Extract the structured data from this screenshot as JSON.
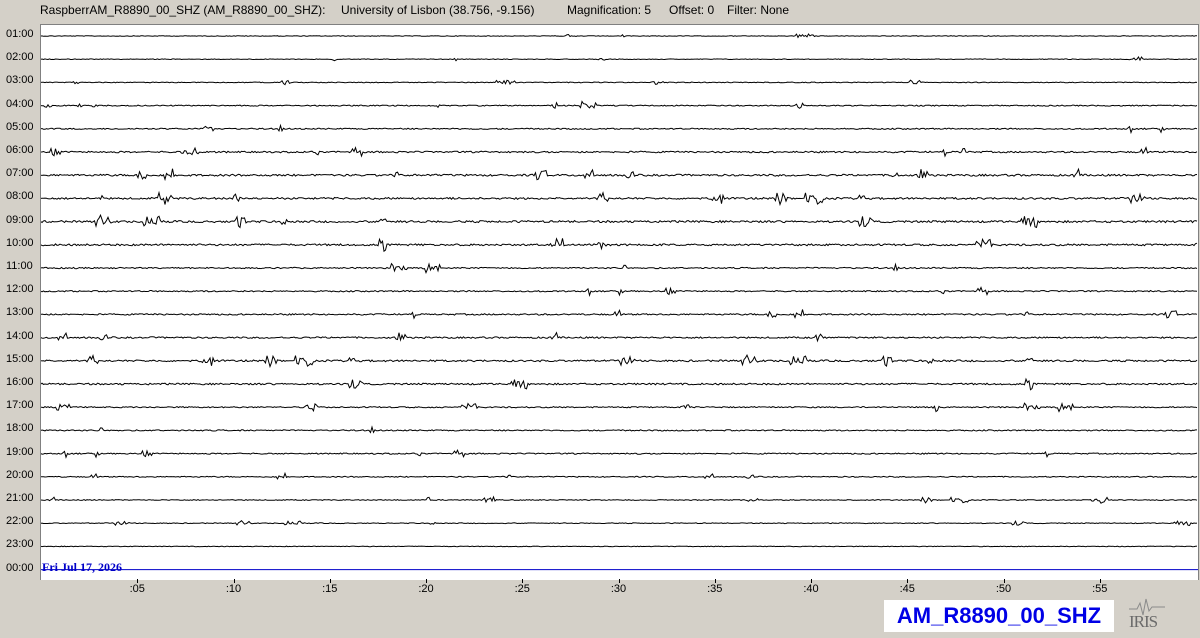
{
  "header": {
    "channel": "RaspberrAM_R8890_00_SHZ (AM_R8890_00_SHZ):",
    "location": "University of Lisbon (38.756, -9.156)",
    "magnification": "Magnification: 5",
    "offset": "Offset: 0",
    "filter": "Filter: None"
  },
  "hours": [
    "01:00",
    "02:00",
    "03:00",
    "04:00",
    "05:00",
    "06:00",
    "07:00",
    "08:00",
    "09:00",
    "10:00",
    "11:00",
    "12:00",
    "13:00",
    "14:00",
    "15:00",
    "16:00",
    "17:00",
    "18:00",
    "19:00",
    "20:00",
    "21:00",
    "22:00",
    "23:00",
    "00:00"
  ],
  "trace_amplitude": [
    0.25,
    0.3,
    0.35,
    0.5,
    0.55,
    0.7,
    0.85,
    0.85,
    0.9,
    0.85,
    0.6,
    0.6,
    0.65,
    0.7,
    0.8,
    0.75,
    0.55,
    0.55,
    0.55,
    0.45,
    0.4,
    0.35,
    0.3,
    0
  ],
  "date": "Fri Jul 17, 2026",
  "minute_ticks": [
    ":05",
    ":10",
    ":15",
    ":20",
    ":25",
    ":30",
    ":35",
    ":40",
    ":45",
    ":50",
    ":55"
  ],
  "station_label": "AM_R8890_00_SHZ",
  "logo_text": "IRIS",
  "colors": {
    "trace": "#000000",
    "current_line": "#0000c8",
    "station_text": "#0000e6",
    "background": "#d4d0c8"
  }
}
